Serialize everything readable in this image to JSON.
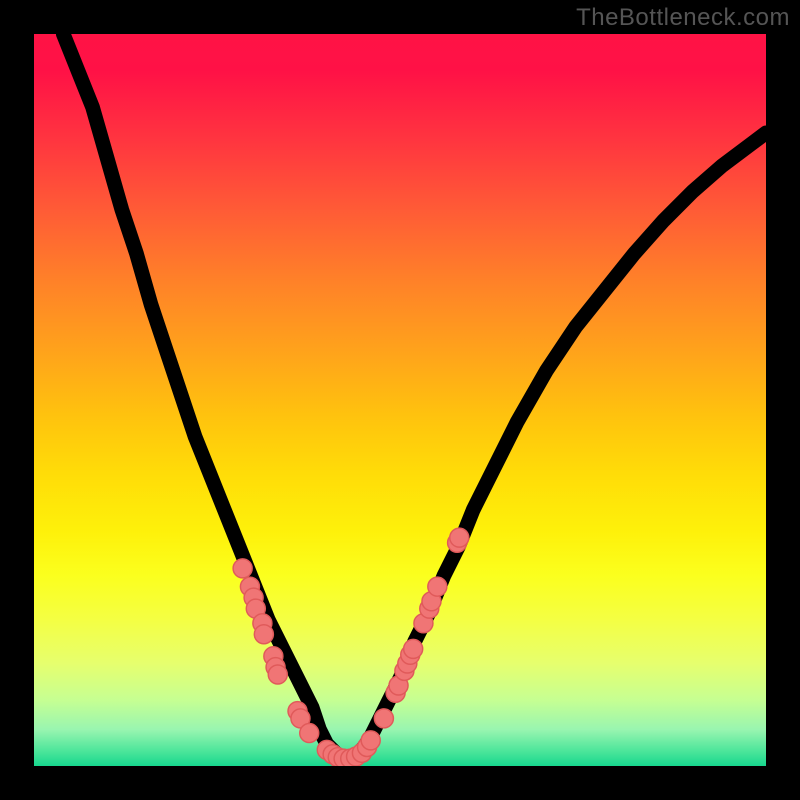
{
  "watermark": "TheBottleneck.com",
  "colors": {
    "page_bg": "#000000",
    "dot_fill": "#f07575",
    "dot_stroke": "#e05a5a",
    "line": "#000000"
  },
  "chart_data": {
    "type": "line",
    "title": "",
    "xlabel": "",
    "ylabel": "",
    "xlim": [
      0,
      100
    ],
    "ylim": [
      0,
      100
    ],
    "grid": false,
    "series": [
      {
        "name": "curve",
        "x": [
          4,
          6,
          8,
          10,
          12,
          14,
          16,
          18,
          20,
          22,
          24,
          26,
          28,
          30,
          32,
          34,
          36,
          38,
          39,
          40,
          41,
          42,
          43,
          44,
          45,
          46,
          48,
          50,
          52,
          54,
          56,
          58,
          60,
          62,
          66,
          70,
          74,
          78,
          82,
          86,
          90,
          94,
          98,
          100
        ],
        "y": [
          100,
          95,
          90,
          83,
          76,
          70,
          63,
          57,
          51,
          45,
          40,
          35,
          30,
          25,
          20,
          16,
          12,
          8,
          5,
          3,
          2,
          1,
          1,
          1.5,
          2.5,
          4,
          8,
          12,
          17,
          21,
          26,
          30,
          35,
          39,
          47,
          54,
          60,
          65,
          70,
          74.5,
          78.5,
          82,
          85,
          86.5
        ]
      }
    ],
    "points": {
      "name": "scatter-markers",
      "coords": [
        [
          28.5,
          27
        ],
        [
          29.5,
          24.5
        ],
        [
          30.0,
          23
        ],
        [
          30.3,
          21.5
        ],
        [
          31.2,
          19.5
        ],
        [
          31.4,
          18
        ],
        [
          32.7,
          15
        ],
        [
          33.0,
          13.5
        ],
        [
          33.3,
          12.5
        ],
        [
          36.0,
          7.5
        ],
        [
          36.4,
          6.5
        ],
        [
          37.6,
          4.5
        ],
        [
          40.0,
          2.2
        ],
        [
          40.8,
          1.6
        ],
        [
          41.5,
          1.2
        ],
        [
          42.3,
          1.0
        ],
        [
          43.2,
          1.0
        ],
        [
          44.0,
          1.3
        ],
        [
          44.8,
          1.8
        ],
        [
          45.5,
          2.6
        ],
        [
          46.0,
          3.5
        ],
        [
          47.8,
          6.5
        ],
        [
          49.4,
          10
        ],
        [
          49.8,
          11
        ],
        [
          50.6,
          13
        ],
        [
          51.0,
          14
        ],
        [
          51.4,
          15.2
        ],
        [
          51.8,
          16
        ],
        [
          53.2,
          19.5
        ],
        [
          54.0,
          21.5
        ],
        [
          54.3,
          22.5
        ],
        [
          55.1,
          24.5
        ],
        [
          57.8,
          30.5
        ],
        [
          58.1,
          31.2
        ]
      ]
    }
  }
}
